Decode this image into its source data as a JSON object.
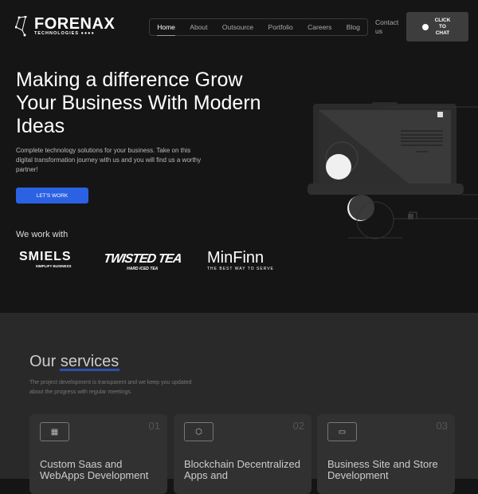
{
  "header": {
    "logo_name": "FORENAX",
    "logo_sub": "TECHNOLOGIES ●●●●",
    "nav": [
      "Home",
      "About",
      "Outsource",
      "Portfolio",
      "Careers",
      "Blog"
    ],
    "contact": "Contact us",
    "chat": "CLICK TO CHAT"
  },
  "hero": {
    "title_pre": "Making a difference Grow Your Business With ",
    "title_hl": "Modern Ideas",
    "description": "Complete technology solutions for your business. Take on this digital transformation journey with us and you will find us a worthy partner!",
    "cta": "LET'S WORK",
    "partners_label": "We work with",
    "partners": [
      {
        "name": "SMIELS",
        "tag": "SIMPLIFY BUSINESS"
      },
      {
        "name": "TWISTED TEA",
        "tag": "HARD ICED TEA"
      },
      {
        "name": "MinFinn",
        "tag": "THE BEST WAY TO SERVE"
      }
    ]
  },
  "services": {
    "title_pre": "Our ",
    "title_hl": "services",
    "description": "The project development is transparent and we keep you updated about the progress with regular meetings.",
    "cards": [
      {
        "num": "01",
        "title": "Custom Saas and WebApps Development",
        "icon": "webapp-icon"
      },
      {
        "num": "02",
        "title": "Blockchain Decentralized Apps and",
        "icon": "blockchain-icon"
      },
      {
        "num": "03",
        "title": "Business Site and Store Development",
        "icon": "laptop-icon"
      }
    ]
  },
  "colors": {
    "accent": "#2b62e3",
    "hero_bg": "#151515",
    "section_bg": "#292929",
    "card_bg": "#313131"
  }
}
